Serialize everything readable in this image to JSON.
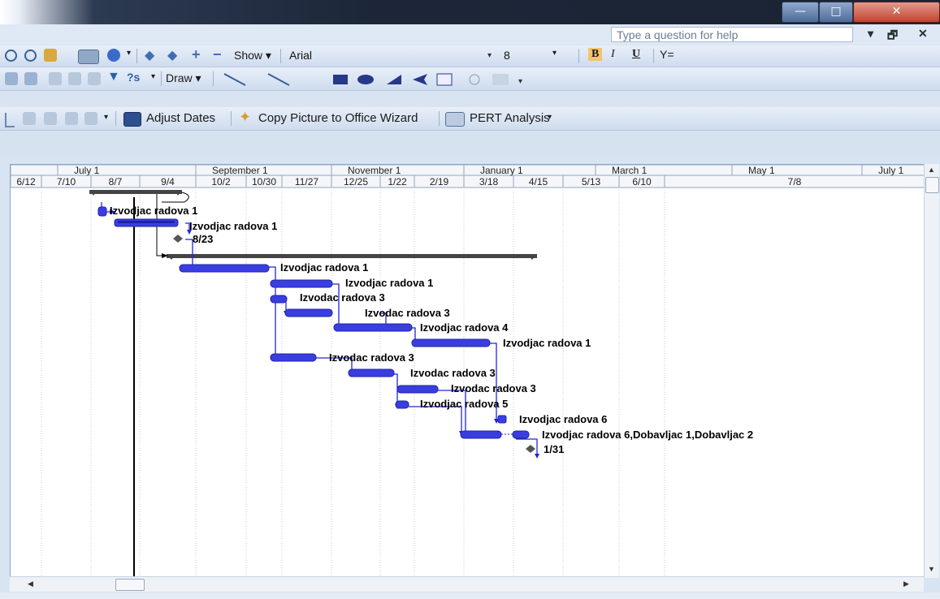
{
  "window": {
    "minimize": "—",
    "maximize": "□",
    "close": "✕"
  },
  "menubar": {
    "help_placeholder": "Type a question for help",
    "mdi_dropdown": "▾",
    "mdi_restore": "🗗",
    "mdi_close": "✕"
  },
  "toolbar_standard": {
    "show_label": "Show",
    "font": "Arial",
    "size": "8",
    "bold": "B",
    "italic": "I",
    "underline": "U",
    "filter": "Y="
  },
  "toolbar_drawing": {
    "draw_label": "Draw"
  },
  "toolbar_analysis": {
    "adjust_dates": "Adjust Dates",
    "copy_picture": "Copy Picture to Office Wizard",
    "pert": "PERT Analysis"
  },
  "timescale": {
    "major": [
      "July 1",
      "September 1",
      "November 1",
      "January 1",
      "March 1",
      "May 1",
      "July 1"
    ],
    "minor": [
      "6/12",
      "7/10",
      "8/7",
      "9/4",
      "10/2",
      "10/30",
      "11/27",
      "12/25",
      "1/22",
      "2/19",
      "3/18",
      "4/15",
      "5/13",
      "6/10",
      "7/8"
    ]
  },
  "tasks": {
    "t1": "Izvodjac radova 1",
    "t2": "Izvodjac radova 1",
    "m1": "8/23",
    "t3": "Izvodjac radova 1",
    "t4": "Izvodjac radova 1",
    "t5": "Izvodac radova 3",
    "t6": "Izvodac radova 3",
    "t7": "Izvodjac radova 4",
    "t8": "Izvodjac radova 1",
    "t9": "Izvodac radova 3",
    "t10": "Izvodac radova 3",
    "t11": "Izvodac radova 3",
    "t12": "Izvodjac radova 5",
    "t13": "Izvodjac radova 6",
    "t14": "Izvodjac radova 6,Dobavljac 1,Dobavljac 2",
    "m2": "1/31"
  },
  "colors": {
    "bar": "#3a3ee0",
    "bar_dark": "#1f22a8",
    "summary": "#444444",
    "link": "#2226d8"
  }
}
